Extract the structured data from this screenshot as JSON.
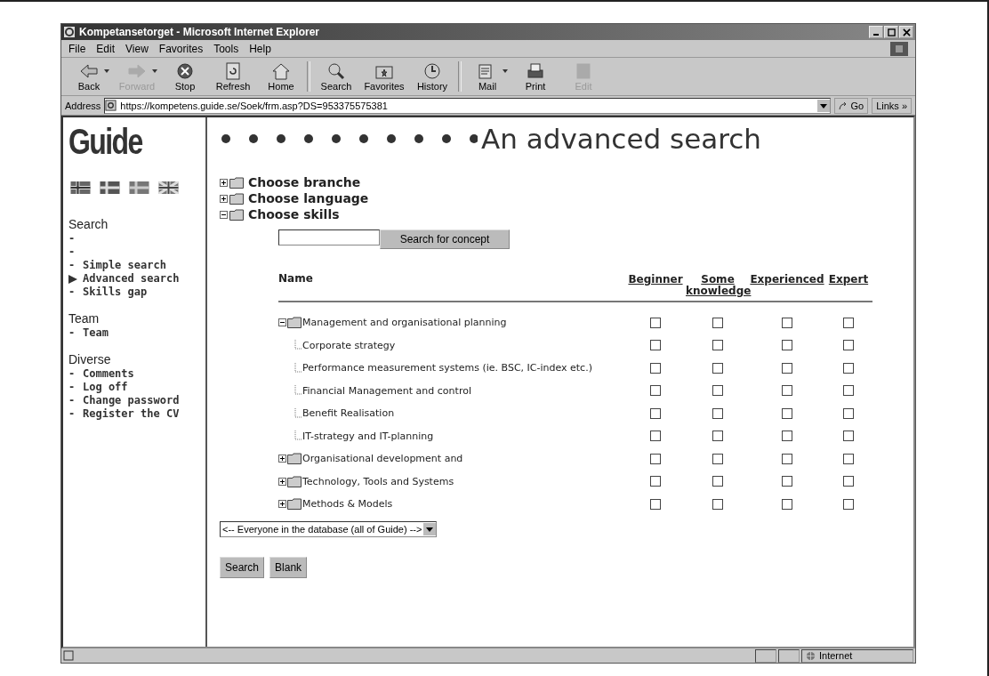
{
  "window": {
    "title": "Kompetansetorget - Microsoft Internet Explorer"
  },
  "menu": [
    "File",
    "Edit",
    "View",
    "Favorites",
    "Tools",
    "Help"
  ],
  "toolbar": [
    {
      "kind": "back",
      "label": "Back",
      "disabled": false,
      "dropdown": true
    },
    {
      "kind": "forward",
      "label": "Forward",
      "disabled": true,
      "dropdown": true
    },
    {
      "kind": "stop",
      "label": "Stop",
      "disabled": false,
      "dropdown": false
    },
    {
      "kind": "refresh",
      "label": "Refresh",
      "disabled": false,
      "dropdown": false
    },
    {
      "kind": "home",
      "label": "Home",
      "disabled": false,
      "dropdown": false
    },
    {
      "kind": "search",
      "label": "Search",
      "disabled": false,
      "dropdown": false
    },
    {
      "kind": "favorites",
      "label": "Favorites",
      "disabled": false,
      "dropdown": false
    },
    {
      "kind": "history",
      "label": "History",
      "disabled": false,
      "dropdown": false
    },
    {
      "kind": "mail",
      "label": "Mail",
      "disabled": false,
      "dropdown": true
    },
    {
      "kind": "print",
      "label": "Print",
      "disabled": false,
      "dropdown": false
    },
    {
      "kind": "edit",
      "label": "Edit",
      "disabled": true,
      "dropdown": false
    }
  ],
  "address": {
    "label": "Address",
    "url": "https://kompetens.guide.se/Soek/frm.asp?DS=953375575381",
    "go": "Go",
    "links": "Links »"
  },
  "sidebar": {
    "logo": "Guide",
    "sections": [
      {
        "heading": "Search",
        "items": [
          {
            "marker": "-",
            "selected": false
          },
          {
            "marker": "-",
            "selected": false
          },
          {
            "marker": "-",
            "label": "Simple search",
            "selected": false
          },
          {
            "label": "Advanced search",
            "selected": true
          },
          {
            "marker": "-",
            "label": "Skills gap",
            "selected": false
          }
        ]
      },
      {
        "heading": "Team",
        "items": [
          {
            "marker": "-",
            "label": "Team",
            "selected": false
          }
        ]
      },
      {
        "heading": "Diverse",
        "items": [
          {
            "marker": "-",
            "label": "Comments",
            "selected": false
          },
          {
            "marker": "-",
            "label": "Log off",
            "selected": false
          },
          {
            "marker": "-",
            "label": "Change password",
            "selected": false
          },
          {
            "marker": "-",
            "label": "Register the CV",
            "selected": false
          }
        ]
      }
    ]
  },
  "main": {
    "title": "An advanced search",
    "categories": [
      {
        "label": "Choose branche",
        "expanded": false
      },
      {
        "label": "Choose language",
        "expanded": false
      },
      {
        "label": "Choose skills",
        "expanded": true
      }
    ],
    "concept_search": {
      "button": "Search for concept"
    },
    "table": {
      "columns": [
        "Name",
        "Beginner",
        "Some knowledge",
        "Experienced",
        "Expert"
      ],
      "rows": [
        {
          "label": "Management and organisational planning",
          "expanded": true,
          "checks": [
            false,
            false,
            false,
            false
          ],
          "children": [
            {
              "label": "Corporate strategy",
              "checks": [
                false,
                false,
                false,
                false
              ]
            },
            {
              "label": "Performance measurement systems (ie. BSC, IC-index etc.)",
              "checks": [
                false,
                false,
                false,
                false
              ]
            },
            {
              "label": "Financial Management and control",
              "checks": [
                false,
                false,
                false,
                false
              ]
            },
            {
              "label": "Benefit Realisation",
              "checks": [
                false,
                false,
                false,
                false
              ]
            },
            {
              "label": "IT-strategy and IT-planning",
              "checks": [
                false,
                false,
                false,
                false
              ]
            }
          ]
        },
        {
          "label": "Organisational development and",
          "expanded": false,
          "checks": [
            false,
            false,
            false,
            false
          ]
        },
        {
          "label": "Technology, Tools and Systems",
          "expanded": false,
          "checks": [
            false,
            false,
            false,
            false
          ]
        },
        {
          "label": "Methods & Models",
          "expanded": false,
          "checks": [
            false,
            false,
            false,
            false
          ]
        }
      ]
    },
    "scope": {
      "value": "<-- Everyone in the database (all of Guide) -->"
    },
    "buttons": [
      "Search",
      "Blank"
    ]
  },
  "status_bar": {
    "zone": "Internet"
  }
}
